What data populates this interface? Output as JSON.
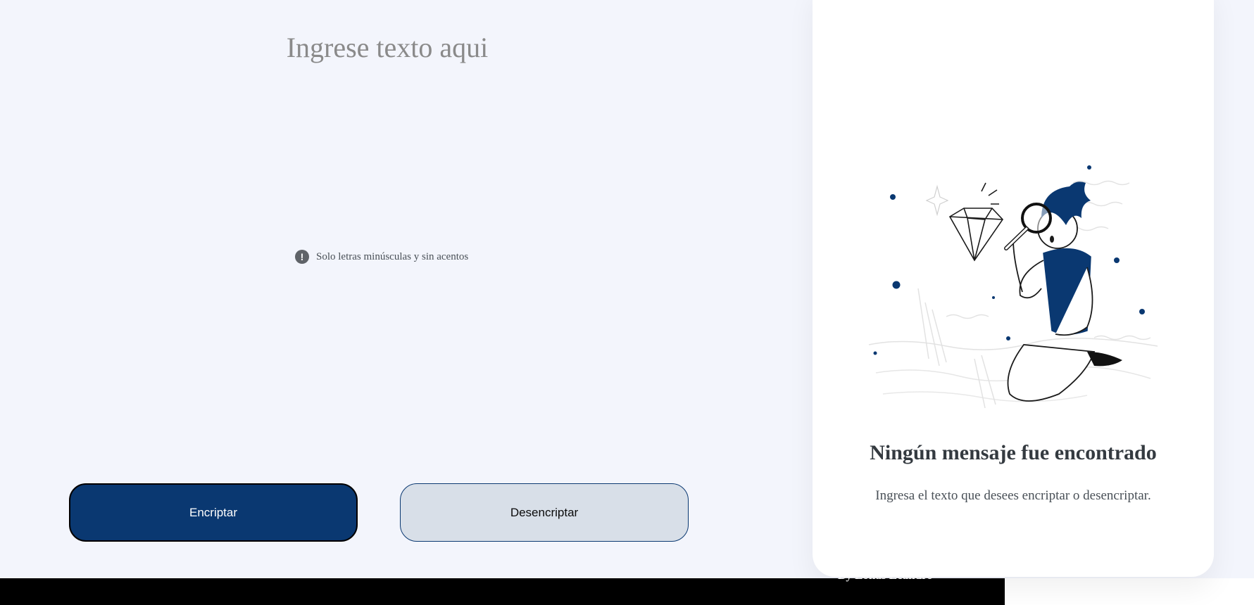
{
  "input": {
    "placeholder": "Ingrese texto aqui",
    "hint": "Solo letras minúsculas y sin acentos",
    "hint_icon": "exclamation-circle-icon"
  },
  "buttons": {
    "encrypt_label": "Encriptar",
    "decrypt_label": "Desencriptar"
  },
  "output": {
    "title": "Ningún mensaje fue encontrado",
    "subtitle": "Ingresa el texto que desees encriptar o desencriptar.",
    "illustration": "person-with-magnifying-glass-and-diamond-illustration"
  },
  "footer": {
    "text": "By Lonas Leandro"
  },
  "colors": {
    "accent": "#0a3871",
    "background": "#f3f5fc",
    "secondary_button": "#d8dfe8"
  }
}
